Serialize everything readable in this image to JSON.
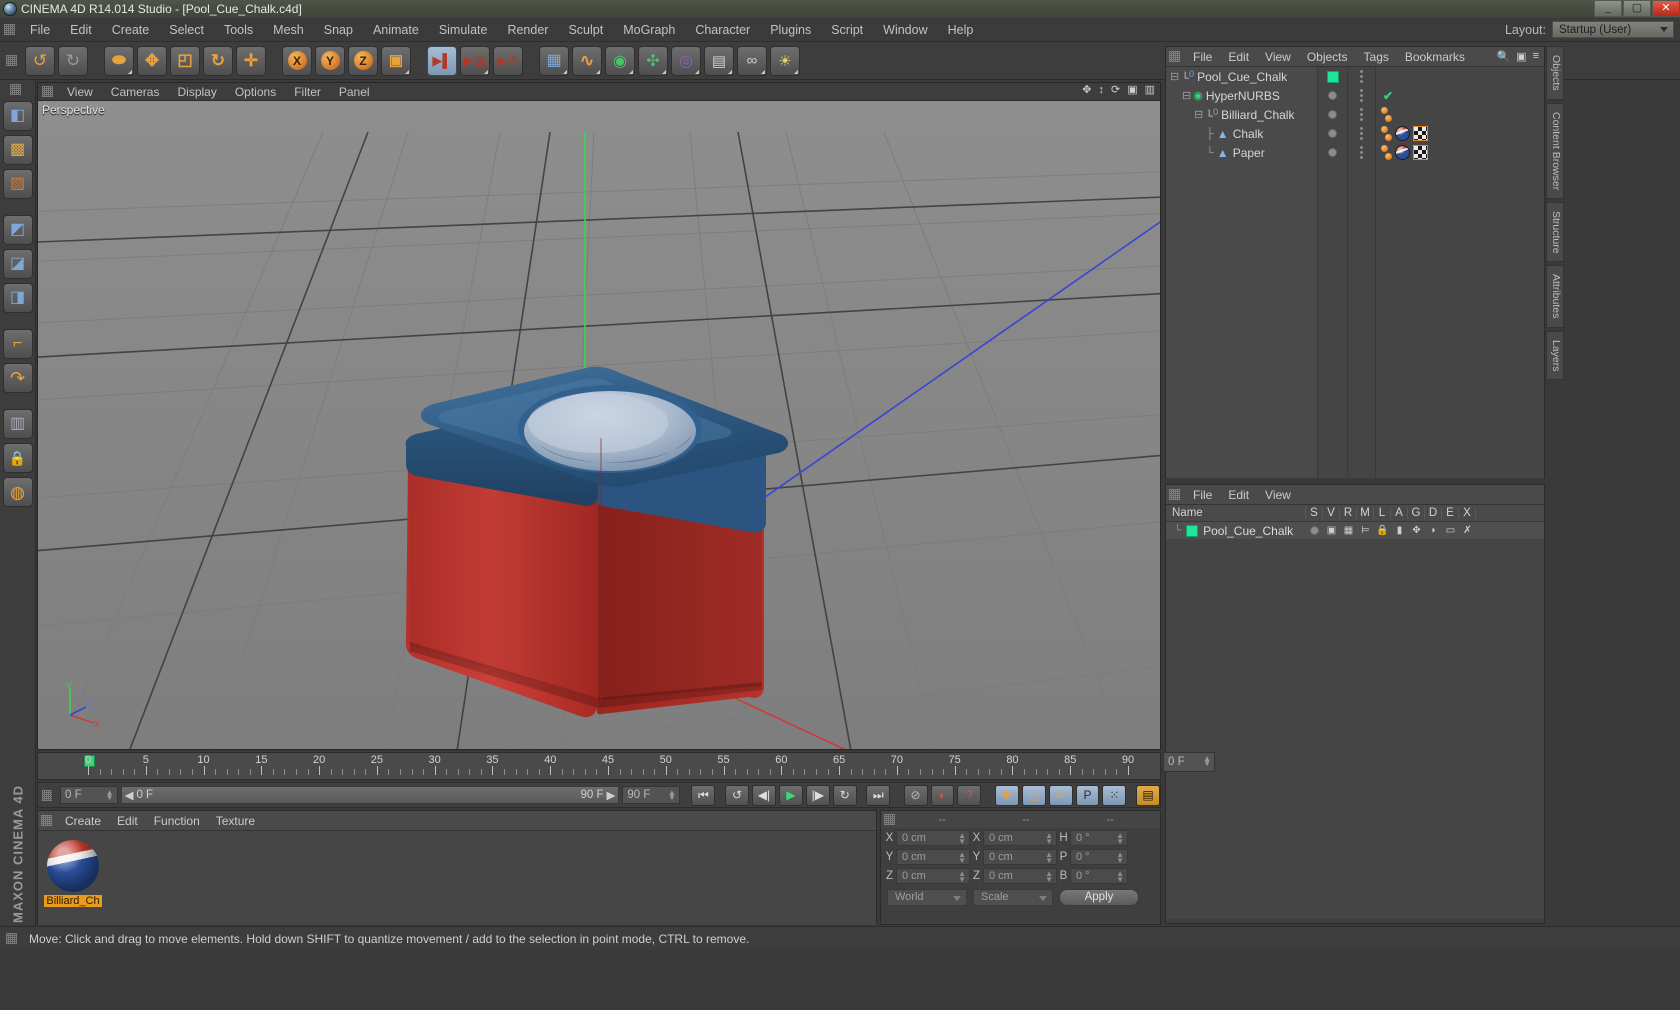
{
  "window": {
    "title": "CINEMA 4D R14.014 Studio - [Pool_Cue_Chalk.c4d]",
    "minimize": "_",
    "maximize": "▢",
    "close": "✕"
  },
  "menubar": {
    "items": [
      "File",
      "Edit",
      "Create",
      "Select",
      "Tools",
      "Mesh",
      "Snap",
      "Animate",
      "Simulate",
      "Render",
      "Sculpt",
      "MoGraph",
      "Character",
      "Plugins",
      "Script",
      "Window",
      "Help"
    ],
    "layout_label": "Layout:",
    "layout_value": "Startup (User)"
  },
  "toolbar": {
    "buttons": [
      {
        "name": "undo-button",
        "glyph": "↺"
      },
      {
        "name": "redo-button",
        "glyph": "↻"
      },
      {
        "name": "live-selection-button",
        "glyph": "⬭"
      },
      {
        "name": "move-tool-button",
        "glyph": "✥"
      },
      {
        "name": "scale-tool-button",
        "glyph": "◰"
      },
      {
        "name": "rotate-tool-button",
        "glyph": "↻"
      },
      {
        "name": "move-axis-button",
        "glyph": "✛"
      },
      {
        "name": "lock-x-axis-button",
        "glyph": "X"
      },
      {
        "name": "lock-y-axis-button",
        "glyph": "Y"
      },
      {
        "name": "lock-z-axis-button",
        "glyph": "Z"
      },
      {
        "name": "world-object-coord-button",
        "glyph": "▣"
      },
      {
        "name": "render-view-button",
        "glyph": "▶"
      },
      {
        "name": "render-region-button",
        "glyph": "▶"
      },
      {
        "name": "render-settings-button",
        "glyph": "▶"
      },
      {
        "name": "add-cube-button",
        "glyph": "▦"
      },
      {
        "name": "add-spline-button",
        "glyph": "∿"
      },
      {
        "name": "add-nurbs-button",
        "glyph": "◉"
      },
      {
        "name": "add-array-button",
        "glyph": "✣"
      },
      {
        "name": "add-deformer-button",
        "glyph": "◎"
      },
      {
        "name": "add-camera-button",
        "glyph": "▤"
      },
      {
        "name": "add-scene-button",
        "glyph": "∞"
      },
      {
        "name": "add-light-button",
        "glyph": "💡"
      }
    ]
  },
  "left_palette": {
    "buttons": [
      {
        "name": "model-mode-button",
        "glyph": "◧"
      },
      {
        "name": "texture-mode-button",
        "glyph": "▩"
      },
      {
        "name": "points-mode-button",
        "glyph": "▨"
      },
      {
        "name": "edges-mode-button",
        "glyph": "◩"
      },
      {
        "name": "polygons-mode-button",
        "glyph": "◪"
      },
      {
        "name": "axis-mode-button",
        "glyph": "⌐"
      },
      {
        "name": "enable-axis-button",
        "glyph": "↷"
      },
      {
        "name": "viewport-solo-button",
        "glyph": "▥"
      },
      {
        "name": "lock-workplane-button",
        "glyph": "🔒"
      },
      {
        "name": "workplane-button",
        "glyph": "◍"
      }
    ],
    "brand": "MAXON CINEMA 4D"
  },
  "viewport": {
    "menus": [
      "View",
      "Cameras",
      "Display",
      "Options",
      "Filter",
      "Panel"
    ],
    "label": "Perspective",
    "axis_x": "X",
    "axis_y": "Y",
    "axis_z": "Z",
    "header_icons": [
      "pan-icon",
      "zoom-icon",
      "orbit-icon",
      "maximize-icon",
      "layout-icon"
    ]
  },
  "object_manager": {
    "menus": [
      "File",
      "Edit",
      "View",
      "Objects",
      "Tags",
      "Bookmarks"
    ],
    "rows": [
      {
        "name": "Pool_Cue_Chalk",
        "indent": 0,
        "icon": "null-object-icon",
        "expanded": true,
        "color_box": true,
        "tags": []
      },
      {
        "name": "HyperNURBS",
        "indent": 1,
        "icon": "hypernurbs-icon",
        "expanded": true,
        "check": true,
        "tags": []
      },
      {
        "name": "Billiard_Chalk",
        "indent": 2,
        "icon": "null-object-icon",
        "expanded": true,
        "tags": [
          "dot"
        ]
      },
      {
        "name": "Chalk",
        "indent": 3,
        "icon": "polygon-object-icon",
        "expanded": false,
        "tags": [
          "dot",
          "material",
          "uvw"
        ]
      },
      {
        "name": "Paper",
        "indent": 3,
        "icon": "polygon-object-icon",
        "expanded": false,
        "tags": [
          "dot",
          "material",
          "uvw"
        ]
      }
    ]
  },
  "layer_manager": {
    "menus": [
      "File",
      "Edit",
      "View"
    ],
    "columns": [
      "Name",
      "S",
      "V",
      "R",
      "M",
      "L",
      "A",
      "G",
      "D",
      "E",
      "X"
    ],
    "rows": [
      {
        "name": "Pool_Cue_Chalk",
        "color": "#21e39a",
        "cells": [
          "◉",
          "▣",
          "▦",
          "⊨",
          "🔒",
          "▮",
          "✥",
          "◗",
          "▭",
          "✗"
        ]
      }
    ]
  },
  "right_tabs": [
    "Objects",
    "Content Browser",
    "Structure",
    "Attributes",
    "Layers"
  ],
  "timeline": {
    "ticks": [
      0,
      5,
      10,
      15,
      20,
      25,
      30,
      35,
      40,
      45,
      50,
      55,
      60,
      65,
      70,
      75,
      80,
      85,
      90
    ],
    "current_frame_label": "0 F",
    "frame_field": "0 F",
    "start_field": "0 F",
    "end_field": "90 F",
    "range_end": "90 F",
    "preview_end": "90 F"
  },
  "playback": {
    "buttons": [
      {
        "name": "go-to-start-button",
        "glyph": "⏮"
      },
      {
        "name": "play-back-loop-button",
        "glyph": "↺"
      },
      {
        "name": "step-back-button",
        "glyph": "◀|"
      },
      {
        "name": "play-button",
        "glyph": "▶"
      },
      {
        "name": "step-forward-button",
        "glyph": "|▶"
      },
      {
        "name": "play-forward-loop-button",
        "glyph": "↻"
      },
      {
        "name": "go-to-end-button",
        "glyph": "⏭"
      }
    ],
    "record_buttons": [
      {
        "name": "record-active-objects-button",
        "glyph": "⊘"
      },
      {
        "name": "autokeying-button",
        "glyph": "◐"
      },
      {
        "name": "keyframe-selection-button",
        "glyph": "?"
      }
    ],
    "param_buttons": [
      {
        "name": "position-key-button",
        "glyph": "✥"
      },
      {
        "name": "scale-key-button",
        "glyph": "◰"
      },
      {
        "name": "rotation-key-button",
        "glyph": "↻"
      },
      {
        "name": "parameter-key-button",
        "glyph": "P"
      },
      {
        "name": "point-level-anim-button",
        "glyph": "⁙"
      },
      {
        "name": "keyframe-mode-button",
        "glyph": "▤"
      }
    ]
  },
  "material_manager": {
    "menus": [
      "Create",
      "Edit",
      "Function",
      "Texture"
    ],
    "materials": [
      {
        "name": "Billiard_Ch",
        "selected": true
      }
    ]
  },
  "coordinates": {
    "headers": [
      "--",
      "--",
      "--"
    ],
    "rows": [
      {
        "label_pos": "X",
        "value_pos": "0 cm",
        "label_size": "X",
        "value_size": "0 cm",
        "label_rot": "H",
        "value_rot": "0 °"
      },
      {
        "label_pos": "Y",
        "value_pos": "0 cm",
        "label_size": "Y",
        "value_size": "0 cm",
        "label_rot": "P",
        "value_rot": "0 °"
      },
      {
        "label_pos": "Z",
        "value_pos": "0 cm",
        "label_size": "Z",
        "value_size": "0 cm",
        "label_rot": "B",
        "value_rot": "0 °"
      }
    ],
    "coord_system": "World",
    "size_mode": "Scale",
    "apply_label": "Apply"
  },
  "status_bar": {
    "text": "Move: Click and drag to move elements. Hold down SHIFT to quantize movement / add to the selection in point mode, CTRL to remove."
  },
  "colors": {
    "accent_orange": "#e8a33d",
    "selected_blue": "#8fa9c6",
    "green": "#21e39a",
    "chalk_blue": "#2f5f8f",
    "chalk_red": "#c0392c"
  }
}
